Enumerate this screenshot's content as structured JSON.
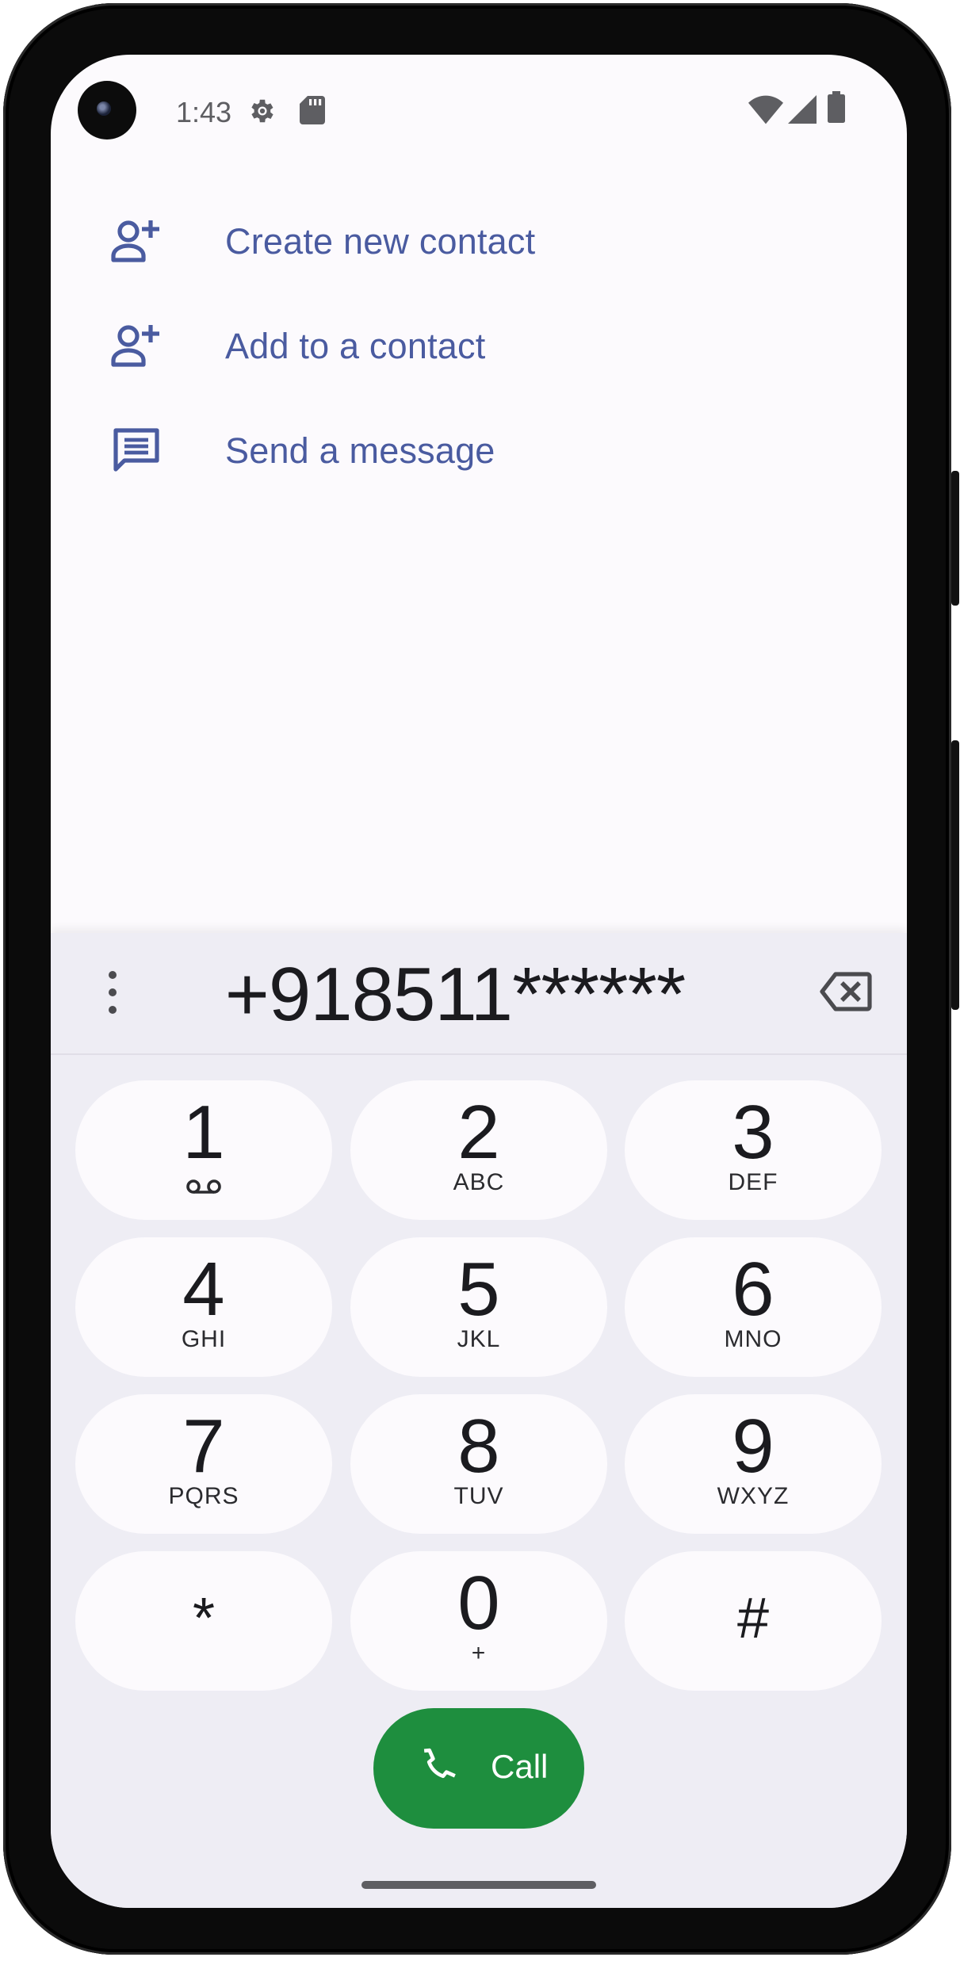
{
  "status_bar": {
    "time": "1:43",
    "icons": [
      "settings-gear-icon",
      "sd-card-icon",
      "wifi-icon",
      "cellular-signal-icon",
      "battery-icon"
    ]
  },
  "suggestions": [
    {
      "icon": "person-add-icon",
      "label": "Create new contact"
    },
    {
      "icon": "person-add-icon",
      "label": "Add to a contact"
    },
    {
      "icon": "message-icon",
      "label": "Send a message"
    }
  ],
  "dialpad": {
    "entered_number": "+918511******",
    "keys": [
      {
        "digit": "1",
        "letters": "",
        "icon": "voicemail-icon"
      },
      {
        "digit": "2",
        "letters": "ABC"
      },
      {
        "digit": "3",
        "letters": "DEF"
      },
      {
        "digit": "4",
        "letters": "GHI"
      },
      {
        "digit": "5",
        "letters": "JKL"
      },
      {
        "digit": "6",
        "letters": "MNO"
      },
      {
        "digit": "7",
        "letters": "PQRS"
      },
      {
        "digit": "8",
        "letters": "TUV"
      },
      {
        "digit": "9",
        "letters": "WXYZ"
      },
      {
        "digit": "*",
        "letters": ""
      },
      {
        "digit": "0",
        "letters": "+"
      },
      {
        "digit": "#",
        "letters": ""
      }
    ]
  },
  "call_button": {
    "label": "Call",
    "icon": "phone-icon"
  },
  "colors": {
    "accent_text": "#4a5ba0",
    "call_green": "#1e8e3e",
    "dialpad_bg": "#eeedf4",
    "key_bg": "#fcfafd"
  }
}
